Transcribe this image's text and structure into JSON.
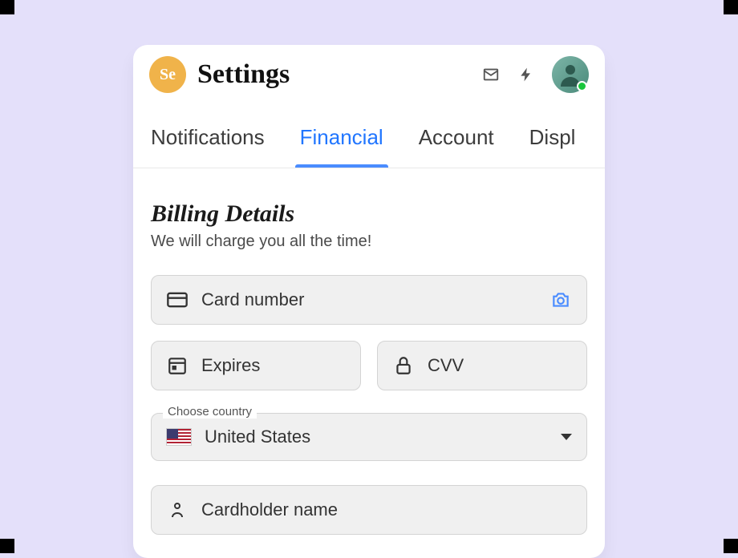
{
  "header": {
    "logo_text": "Se",
    "title": "Settings"
  },
  "tabs": [
    {
      "label": "Notifications",
      "active": false
    },
    {
      "label": "Financial",
      "active": true
    },
    {
      "label": "Account",
      "active": false
    },
    {
      "label": "Displ",
      "active": false
    }
  ],
  "billing": {
    "title": "Billing Details",
    "subtitle": "We will charge you all the time!",
    "card_number_placeholder": "Card number",
    "expires_placeholder": "Expires",
    "cvv_placeholder": "CVV",
    "country_label": "Choose country",
    "country_value": "United States",
    "cardholder_placeholder": "Cardholder name"
  }
}
